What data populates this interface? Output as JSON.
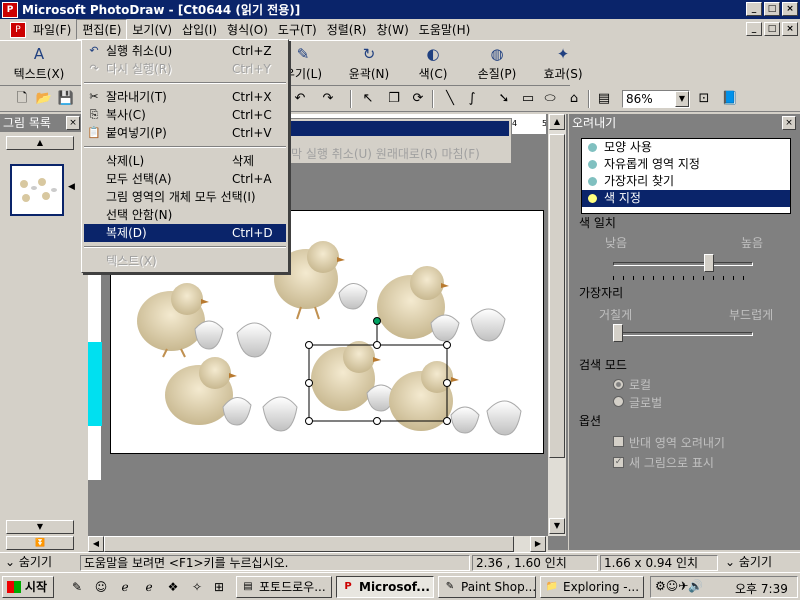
{
  "window": {
    "title": "Microsoft PhotoDraw - [Ct0644 (읽기 전용)]",
    "min": "_",
    "max": "□",
    "close": "×"
  },
  "menubar": [
    "파일(F)",
    "편집(E)",
    "보기(V)",
    "삽입(I)",
    "형식(O)",
    "도구(T)",
    "정렬(R)",
    "창(W)",
    "도움말(H)"
  ],
  "bigtoolbar": {
    "text": "텍스트(X)",
    "erase": "우기(L)",
    "outline": "윤곽(N)",
    "color": "색(C)",
    "touchup": "손질(P)",
    "effects": "효과(S)"
  },
  "zoom": "86%",
  "leftpanel": {
    "title": "그림 목록",
    "close": "×"
  },
  "editmenu": {
    "items": [
      {
        "icon": "↶",
        "label": "실행 취소(U)",
        "shortcut": "Ctrl+Z",
        "enabled": true
      },
      {
        "icon": "↷",
        "label": "다시 실행(R)",
        "shortcut": "Ctrl+Y",
        "enabled": false
      },
      {
        "icon": "✂",
        "label": "잘라내기(T)",
        "shortcut": "Ctrl+X",
        "enabled": true
      },
      {
        "icon": "⎘",
        "label": "복사(C)",
        "shortcut": "Ctrl+C",
        "enabled": true
      },
      {
        "icon": "📋",
        "label": "붙여넣기(P)",
        "shortcut": "Ctrl+V",
        "enabled": true
      },
      {
        "icon": "",
        "label": "삭제(L)",
        "shortcut": "삭제",
        "enabled": true
      },
      {
        "icon": "",
        "label": "모두 선택(A)",
        "shortcut": "Ctrl+A",
        "enabled": true
      },
      {
        "icon": "",
        "label": "그림 영역의 개체 모두 선택(I)",
        "shortcut": "",
        "enabled": true
      },
      {
        "icon": "",
        "label": "선택 안함(N)",
        "shortcut": "",
        "enabled": true
      },
      {
        "icon": "",
        "label": "복제(D)",
        "shortcut": "Ctrl+D",
        "enabled": true,
        "selected": true
      },
      {
        "icon": "",
        "label": "텍스트(X)",
        "shortcut": "",
        "enabled": false
      }
    ]
  },
  "undopanel": {
    "text": "막 실행 취소(U)  원래대로(R)  마침(F)"
  },
  "rightpanel": {
    "title": "오려내기",
    "close": "×",
    "list": [
      "모양 사용",
      "자유롭게 영역 지정",
      "가장자리 찾기",
      "색 지정"
    ],
    "selected_index": 3,
    "color_match": {
      "label": "색 일치",
      "low": "낮음",
      "high": "높음",
      "value": 0.7
    },
    "edge": {
      "label": "가장자리",
      "rough": "거칠게",
      "smooth": "부드럽게",
      "value": 0.0
    },
    "search_mode": {
      "label": "검색 모드",
      "options": [
        "로컬",
        "글로벌"
      ],
      "selected": 0
    },
    "options": {
      "label": "옵션",
      "invert": "반대 영역 오려내기",
      "new_picture": "새 그림으로 표시",
      "invert_checked": false,
      "new_picture_checked": true
    }
  },
  "statusbar": {
    "hide_left": "숨기기",
    "help": "도움말을 보려면 <F1>키를 누르십시오.",
    "position": "2.36 , 1.60 인치",
    "size": "1.66 x 0.94 인치",
    "hide_right": "숨기기"
  },
  "taskbar": {
    "start": "시작",
    "tasks": [
      "포토드로우...",
      "Microsof...",
      "Paint Shop...",
      "Exploring -..."
    ],
    "active_index": 1,
    "clock": "오후 7:39"
  }
}
